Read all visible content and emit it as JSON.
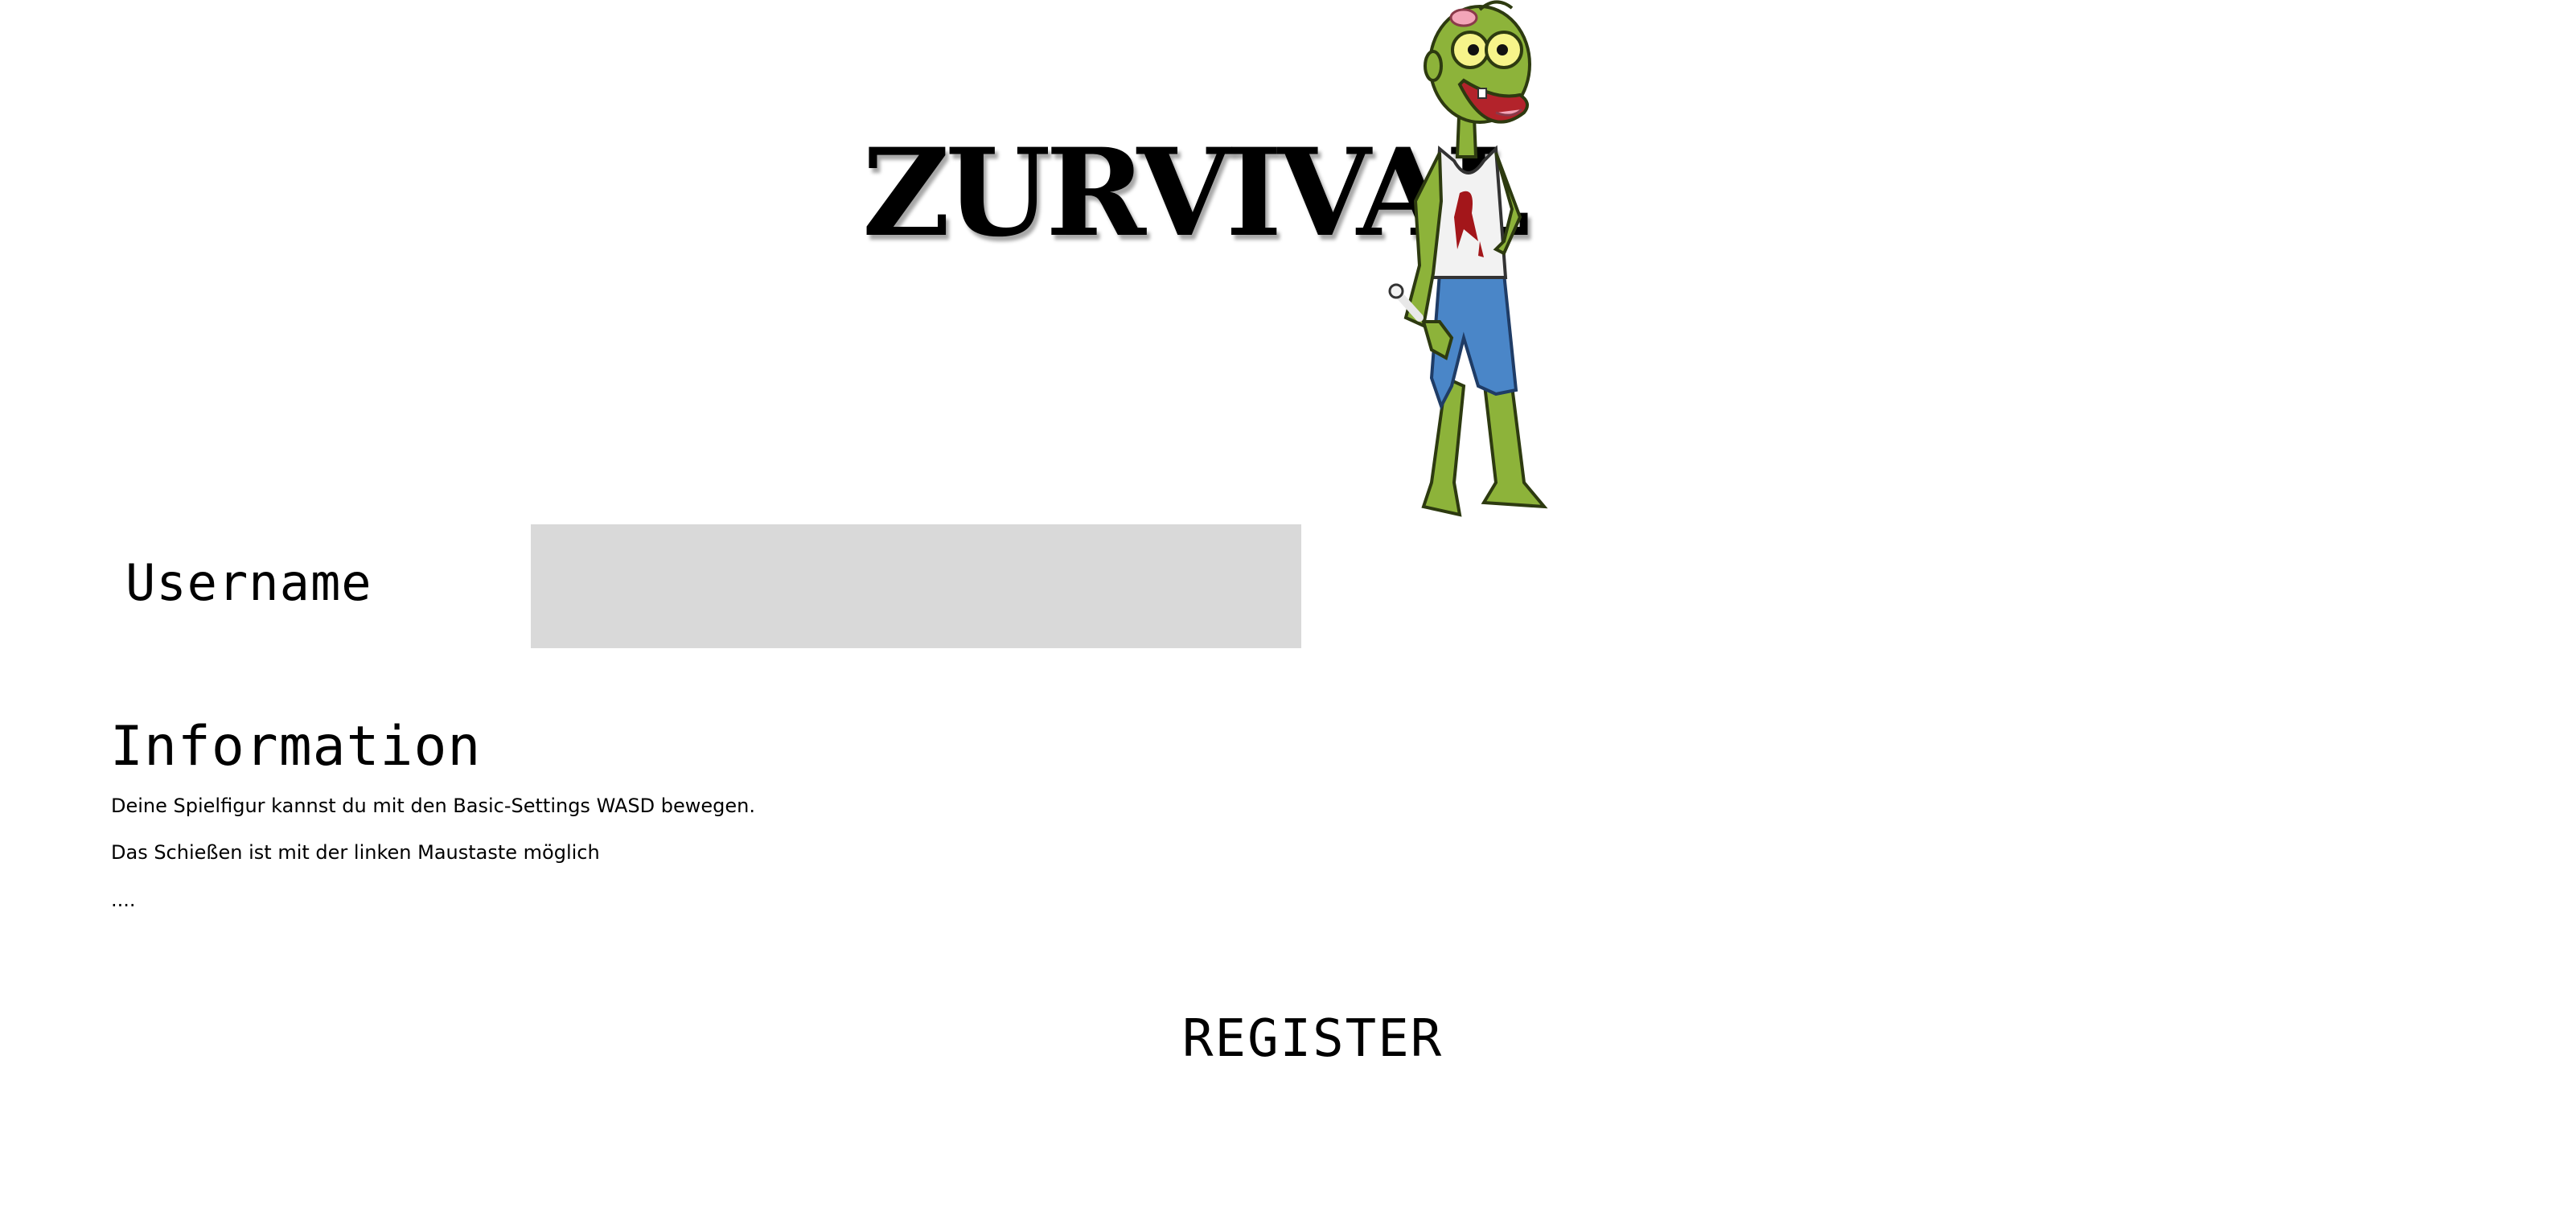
{
  "header": {
    "logo_text": "ZURVIVAL",
    "mascot_icon": "zombie-icon"
  },
  "form": {
    "username_label": "Username",
    "username_value": "",
    "username_placeholder": ""
  },
  "information": {
    "heading": "Information",
    "lines": [
      "Deine Spielfigur kannst du mit den Basic-Settings WASD bewegen.",
      "Das Schießen ist mit der linken Maustaste möglich",
      "...."
    ]
  },
  "actions": {
    "register_label": "REGISTER"
  },
  "colors": {
    "background": "#ffffff",
    "input_background": "#d9d9d9",
    "text": "#000000",
    "zombie_skin": "#8db33a",
    "zombie_pants": "#4a86c8",
    "blood": "#a3161a"
  }
}
